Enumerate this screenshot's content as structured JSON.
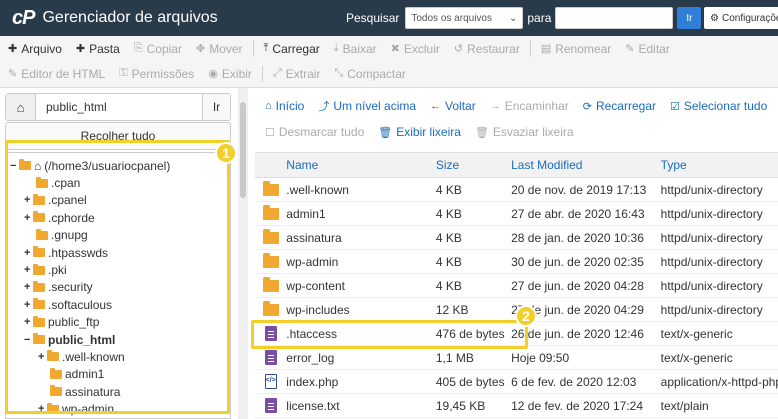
{
  "header": {
    "logo": "cP",
    "title": "Gerenciador de arquivos",
    "search_label": "Pesquisar",
    "search_scope": "Todos os arquivos",
    "para_label": "para",
    "search_value": "",
    "go_label": "Ir",
    "settings_label": "Configurações"
  },
  "toolbar": {
    "row1": [
      {
        "label": "Arquivo",
        "icon": "plus-icon",
        "glyph": "✚",
        "enabled": true
      },
      {
        "label": "Pasta",
        "icon": "plus-icon",
        "glyph": "✚",
        "enabled": true
      },
      {
        "label": "Copiar",
        "icon": "copy-icon",
        "glyph": "⎘",
        "enabled": false
      },
      {
        "label": "Mover",
        "icon": "move-icon",
        "glyph": "✥",
        "enabled": false
      },
      {
        "label": "Carregar",
        "icon": "upload-icon",
        "glyph": "⤒",
        "enabled": true
      },
      {
        "label": "Baixar",
        "icon": "download-icon",
        "glyph": "⤓",
        "enabled": false
      },
      {
        "label": "Excluir",
        "icon": "delete-icon",
        "glyph": "✖",
        "enabled": false
      },
      {
        "label": "Restaurar",
        "icon": "restore-icon",
        "glyph": "↺",
        "enabled": false
      },
      {
        "label": "Renomear",
        "icon": "rename-icon",
        "glyph": "▤",
        "enabled": false
      },
      {
        "label": "Editar",
        "icon": "edit-icon",
        "glyph": "✎",
        "enabled": false
      }
    ],
    "row2": [
      {
        "label": "Editor de HTML",
        "icon": "html-editor-icon",
        "glyph": "✎",
        "enabled": false
      },
      {
        "label": "Permissões",
        "icon": "key-icon",
        "glyph": "⚿",
        "enabled": false
      },
      {
        "label": "Exibir",
        "icon": "eye-icon",
        "glyph": "◉",
        "enabled": false
      },
      {
        "label": "Extrair",
        "icon": "extract-icon",
        "glyph": "⤢",
        "enabled": false
      },
      {
        "label": "Compactar",
        "icon": "compress-icon",
        "glyph": "⤡",
        "enabled": false
      }
    ]
  },
  "left": {
    "path_value": "public_html",
    "go_label": "Ir",
    "collapse_label": "Recolher tudo",
    "tree": [
      {
        "label": "(/home3/usuariocpanel)",
        "toggle": "−",
        "indent": 0,
        "bold": false,
        "home": true
      },
      {
        "label": ".cpan",
        "toggle": "",
        "indent": 1,
        "bold": false
      },
      {
        "label": ".cpanel",
        "toggle": "+",
        "indent": 1,
        "bold": false
      },
      {
        "label": ".cphorde",
        "toggle": "+",
        "indent": 1,
        "bold": false
      },
      {
        "label": ".gnupg",
        "toggle": "",
        "indent": 1,
        "bold": false
      },
      {
        "label": ".htpasswds",
        "toggle": "+",
        "indent": 1,
        "bold": false
      },
      {
        "label": ".pki",
        "toggle": "+",
        "indent": 1,
        "bold": false
      },
      {
        "label": ".security",
        "toggle": "+",
        "indent": 1,
        "bold": false
      },
      {
        "label": ".softaculous",
        "toggle": "+",
        "indent": 1,
        "bold": false
      },
      {
        "label": "public_ftp",
        "toggle": "+",
        "indent": 1,
        "bold": false
      },
      {
        "label": "public_html",
        "toggle": "−",
        "indent": 1,
        "bold": true
      },
      {
        "label": ".well-known",
        "toggle": "+",
        "indent": 2,
        "bold": false
      },
      {
        "label": "admin1",
        "toggle": "",
        "indent": 2,
        "bold": false
      },
      {
        "label": "assinatura",
        "toggle": "",
        "indent": 2,
        "bold": false
      },
      {
        "label": "wp-admin",
        "toggle": "+",
        "indent": 2,
        "bold": false
      }
    ]
  },
  "nav": {
    "row1": [
      {
        "label": "Início",
        "icon": "home-icon",
        "glyph": "⌂",
        "enabled": true
      },
      {
        "label": "Um nível acima",
        "icon": "level-up-icon",
        "glyph": "⤴",
        "enabled": true
      },
      {
        "label": "Voltar",
        "icon": "back-arrow-icon",
        "glyph": "←",
        "enabled": true
      },
      {
        "label": "Encaminhar",
        "icon": "forward-arrow-icon",
        "glyph": "→",
        "enabled": false
      },
      {
        "label": "Recarregar",
        "icon": "reload-icon",
        "glyph": "⟳",
        "enabled": true
      },
      {
        "label": "Selecionar tudo",
        "icon": "checkbox-checked-icon",
        "glyph": "☑",
        "enabled": true
      }
    ],
    "row2": [
      {
        "label": "Desmarcar tudo",
        "icon": "checkbox-empty-icon",
        "glyph": "☐",
        "enabled": false
      },
      {
        "label": "Exibir lixeira",
        "icon": "trash-icon",
        "glyph": "🗑",
        "enabled": true
      },
      {
        "label": "Esvaziar lixeira",
        "icon": "trash-icon",
        "glyph": "🗑",
        "enabled": false
      }
    ]
  },
  "table": {
    "headers": [
      "Name",
      "Size",
      "Last Modified",
      "Type"
    ],
    "rows": [
      {
        "icon": "folder",
        "name": ".well-known",
        "size": "4 KB",
        "modified": "20 de nov. de 2019 17:13",
        "type": "httpd/unix-directory"
      },
      {
        "icon": "folder",
        "name": "admin1",
        "size": "4 KB",
        "modified": "27 de abr. de 2020 16:43",
        "type": "httpd/unix-directory"
      },
      {
        "icon": "folder",
        "name": "assinatura",
        "size": "4 KB",
        "modified": "28 de jan. de 2020 10:36",
        "type": "httpd/unix-directory"
      },
      {
        "icon": "folder",
        "name": "wp-admin",
        "size": "4 KB",
        "modified": "30 de jun. de 2020 02:35",
        "type": "httpd/unix-directory"
      },
      {
        "icon": "folder",
        "name": "wp-content",
        "size": "4 KB",
        "modified": "27 de jun. de 2020 04:28",
        "type": "httpd/unix-directory"
      },
      {
        "icon": "folder",
        "name": "wp-includes",
        "size": "12 KB",
        "modified": "27 de jun. de 2020 04:29",
        "type": "httpd/unix-directory"
      },
      {
        "icon": "doc",
        "name": ".htaccess",
        "size": "476 de bytes",
        "modified": "26 de jun. de 2020 12:46",
        "type": "text/x-generic"
      },
      {
        "icon": "doc",
        "name": "error_log",
        "size": "1,1 MB",
        "modified": "Hoje 09:50",
        "type": "text/x-generic"
      },
      {
        "icon": "php",
        "name": "index.php",
        "size": "405 de bytes",
        "modified": "6 de fev. de 2020 12:03",
        "type": "application/x-httpd-php"
      },
      {
        "icon": "doc",
        "name": "license.txt",
        "size": "19,45 KB",
        "modified": "12 de fev. de 2020 17:24",
        "type": "text/plain"
      }
    ]
  },
  "callouts": {
    "one": "1",
    "two": "2"
  },
  "colors": {
    "topbar": "#293a4a",
    "link": "#1a6bbf",
    "highlight": "#f3cf2a",
    "folder": "#f0a830"
  }
}
